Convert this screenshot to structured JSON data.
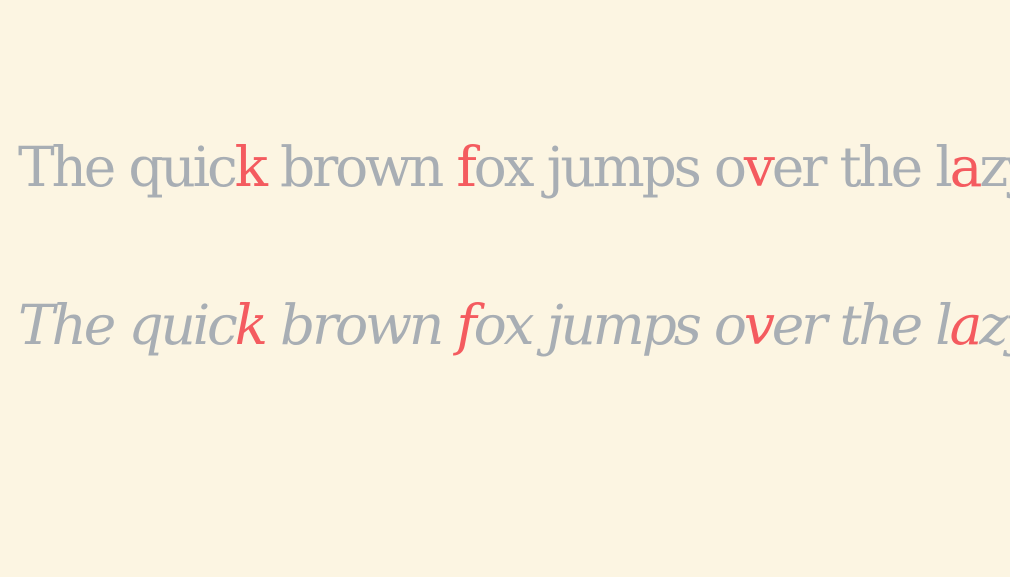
{
  "specimen": {
    "base_color": "#a8aeb4",
    "highlight_color": "#f45b5f",
    "background_color": "#fcf5e2",
    "roman": {
      "segments": [
        {
          "text": "The quic",
          "highlight": false
        },
        {
          "text": "k",
          "highlight": true
        },
        {
          "text": " brown ",
          "highlight": false
        },
        {
          "text": "f",
          "highlight": true
        },
        {
          "text": "ox jumps o",
          "highlight": false
        },
        {
          "text": "v",
          "highlight": true
        },
        {
          "text": "er the l",
          "highlight": false
        },
        {
          "text": "a",
          "highlight": true
        },
        {
          "text": "zy",
          "highlight": false
        }
      ]
    },
    "italic": {
      "segments": [
        {
          "text": "The quic",
          "highlight": false
        },
        {
          "text": "k",
          "highlight": true
        },
        {
          "text": " brown ",
          "highlight": false
        },
        {
          "text": "f",
          "highlight": true
        },
        {
          "text": "ox jumps o",
          "highlight": false
        },
        {
          "text": "v",
          "highlight": true
        },
        {
          "text": "er the l",
          "highlight": false
        },
        {
          "text": "a",
          "highlight": true
        },
        {
          "text": "zy",
          "highlight": false
        }
      ]
    }
  }
}
